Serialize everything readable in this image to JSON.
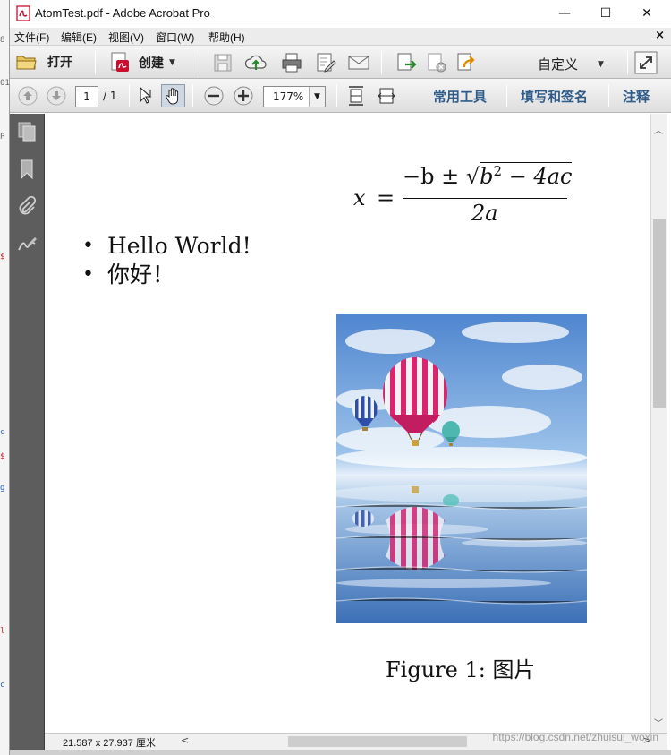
{
  "window": {
    "title": "AtomTest.pdf - Adobe Acrobat Pro",
    "controls": {
      "minimize": "—",
      "maximize": "☐",
      "close": "✕"
    }
  },
  "menu": {
    "items": [
      "文件(F)",
      "编辑(E)",
      "视图(V)",
      "窗口(W)",
      "帮助(H)"
    ],
    "close_doc": "×"
  },
  "toolbar": {
    "open_label": "打开",
    "create_label": "创建",
    "customize_label": "自定义",
    "share_label": "",
    "open_icon": "folder-icon",
    "create_icon": "create-pdf-icon"
  },
  "navbar": {
    "page_current": "1",
    "page_total": "/ 1",
    "zoom": "177%",
    "tab_tools": "常用工具",
    "tab_sign": "填写和签名",
    "tab_comment": "注释"
  },
  "document": {
    "formula": {
      "x": "x",
      "eq": "=",
      "numerator_prefix": "−b ± ",
      "sqrt_symbol": "√",
      "radicand_b": "b",
      "exponent": "2",
      "radicand_rest": " − 4ac",
      "denominator": "2a"
    },
    "bullets": [
      "Hello World!",
      "你好！"
    ],
    "figure_caption": "Figure 1:  图片"
  },
  "status": {
    "page_size": "21.587 x 27.937 厘米"
  },
  "watermark": "https://blog.csdn.net/zhuisui_woxin",
  "colors": {
    "tab_blue": "#2f5c8a",
    "acrobat_red": "#c8102e",
    "balloon_pink": "#d9246e"
  }
}
